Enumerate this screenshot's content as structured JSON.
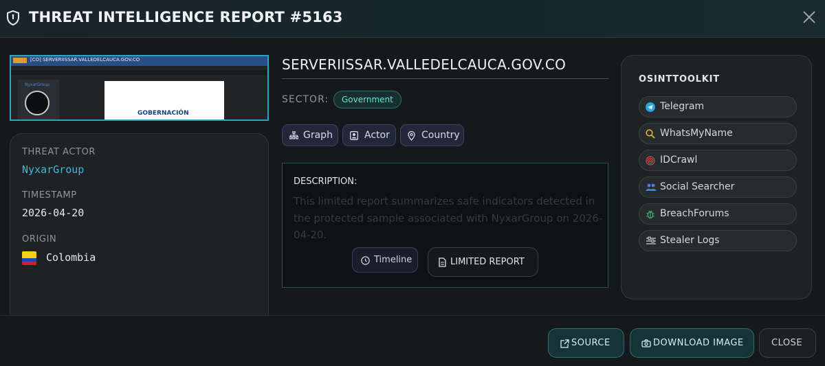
{
  "header": {
    "title": "THREAT INTELLIGENCE REPORT #5163"
  },
  "screenshot": {
    "bar_text": "[CO] SERVERIISSAR.VALLEDELCAUCA.GOV.CO",
    "side_label": "NyxarGroup",
    "page_text": "GOBERNACIÓN"
  },
  "info": {
    "threat_actor_label": "THREAT ACTOR",
    "threat_actor": "NyxarGroup",
    "timestamp_label": "TIMESTAMP",
    "timestamp": "2026-04-20",
    "origin_label": "ORIGIN",
    "origin": "Colombia"
  },
  "report": {
    "domain": "SERVERIISSAR.VALLEDELCAUCA.GOV.CO",
    "sector_label": "SECTOR:",
    "sector": "Government",
    "pills": {
      "graph": "Graph",
      "actor": "Actor",
      "country": "Country"
    },
    "description_label": "DESCRIPTION:",
    "description": "This limited report summarizes safe indicators detected in the protected sample associated with NyxarGroup on 2026-04-20.",
    "timeline_label": "Timeline",
    "limited_label": "LIMITED REPORT"
  },
  "osint": {
    "title": "OSINTTOOLKIT",
    "tools": [
      "Telegram",
      "WhatsMyName",
      "IDCrawl",
      "Social Searcher",
      "BreachForums",
      "Stealer Logs"
    ]
  },
  "footer": {
    "source": "SOURCE",
    "download": "DOWNLOAD IMAGE",
    "close": "CLOSE"
  },
  "colors": {
    "accent": "#2ea4c3",
    "actor_text": "#3fb7e0",
    "sector_badge_text": "#6fe0cf"
  }
}
